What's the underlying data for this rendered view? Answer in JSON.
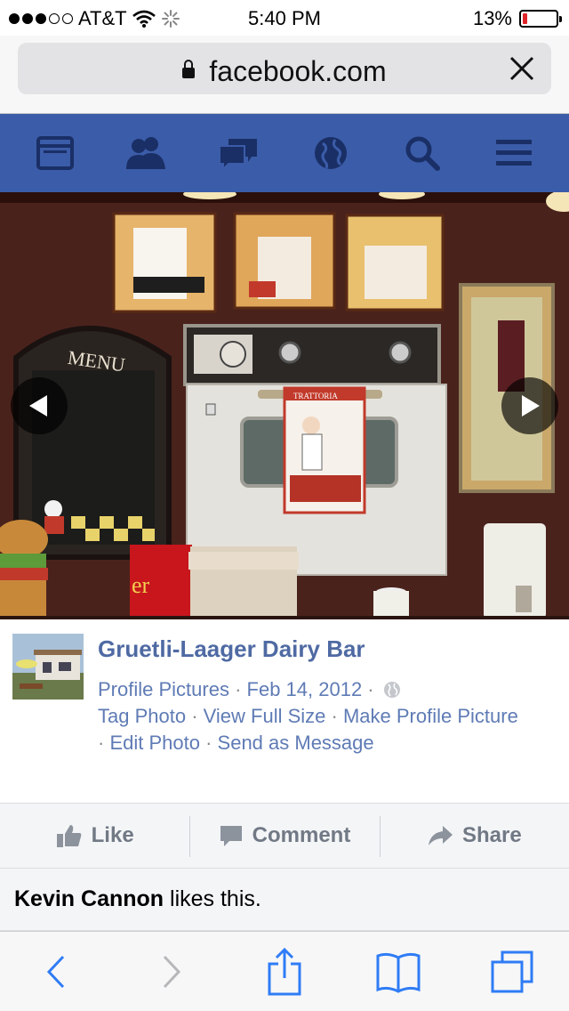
{
  "status_bar": {
    "carrier": "AT&T",
    "time": "5:40 PM",
    "battery_percent": "13%",
    "battery_level": 0.13,
    "signal_bars_filled": 3,
    "signal_bars_total": 5
  },
  "browser": {
    "url": "facebook.com"
  },
  "fb_nav": {
    "items": [
      {
        "name": "news-feed-icon"
      },
      {
        "name": "friend-requests-icon"
      },
      {
        "name": "messages-icon"
      },
      {
        "name": "notifications-globe-icon"
      },
      {
        "name": "search-icon"
      },
      {
        "name": "menu-icon"
      }
    ],
    "color": "#3b5ca8"
  },
  "photo": {
    "menu_board_text": "MENU",
    "towel_text": "TRATTORIA"
  },
  "post": {
    "page_name": "Gruetli-Laager Dairy Bar",
    "album": "Profile Pictures",
    "date": "Feb 14, 2012",
    "actions": {
      "tag": "Tag Photo",
      "full_size": "View Full Size",
      "make_profile": "Make Profile Picture",
      "edit": "Edit Photo",
      "send": "Send as Message"
    }
  },
  "engagement": {
    "like_label": "Like",
    "comment_label": "Comment",
    "share_label": "Share",
    "liker_name": "Kevin Cannon",
    "likes_suffix": " likes this."
  },
  "colors": {
    "link": "#4f6aa3",
    "action_text": "#717985",
    "ios_blue": "#2f7cf6"
  }
}
